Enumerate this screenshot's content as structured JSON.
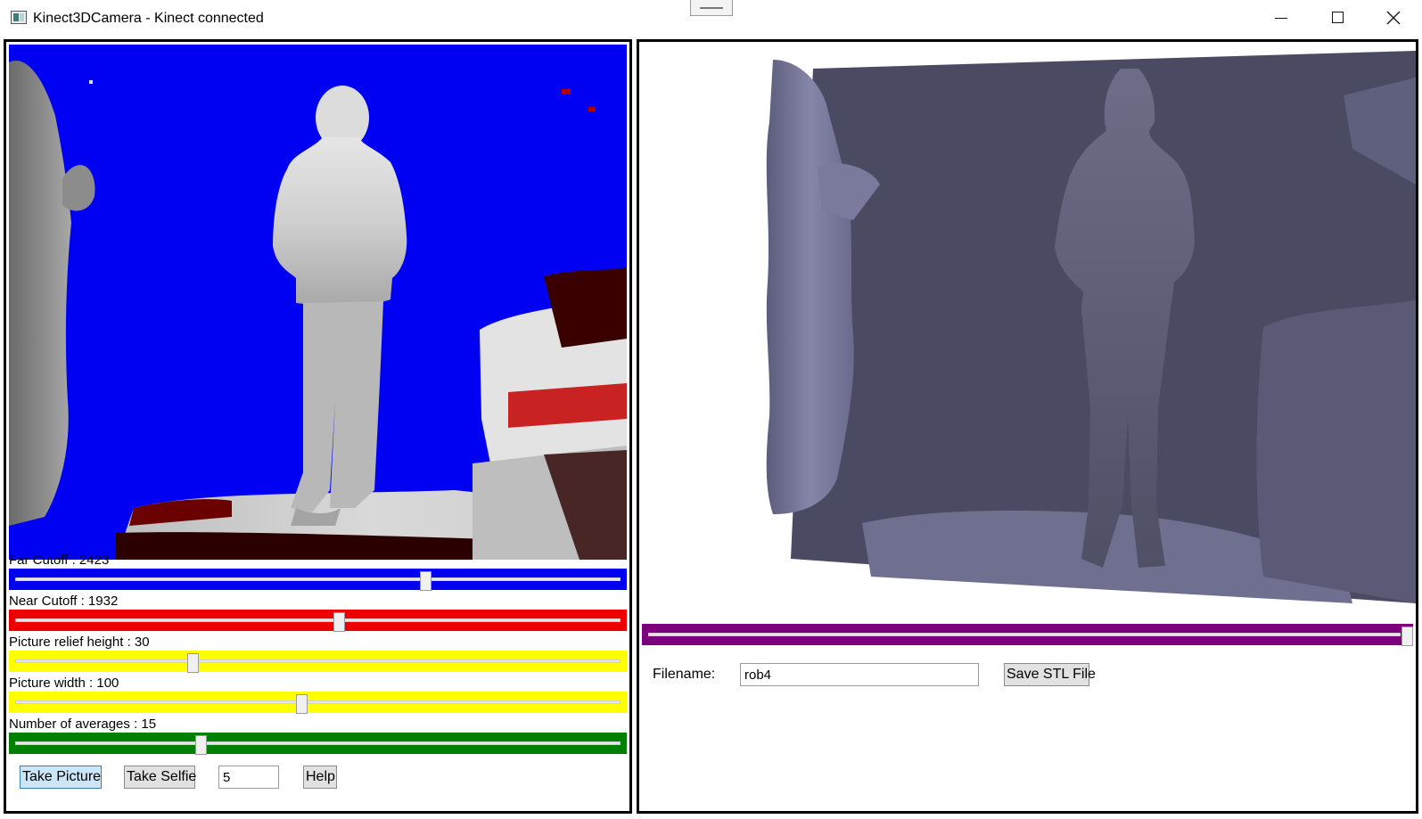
{
  "window": {
    "title": "Kinect3DCamera - Kinect connected",
    "controls": [
      "minimize",
      "maximize",
      "close"
    ]
  },
  "depth_view": {
    "background_color": "#0000f2"
  },
  "sliders": [
    {
      "id": "far_cutoff",
      "label": "Far Cutoff : 2423",
      "color": "#0000ee",
      "position_fraction": 0.678
    },
    {
      "id": "near_cutoff",
      "label": "Near Cutoff : 1932",
      "color": "#ee0000",
      "position_fraction": 0.536
    },
    {
      "id": "relief_height",
      "label": "Picture relief height : 30",
      "color": "#ffff00",
      "position_fraction": 0.294
    },
    {
      "id": "picture_width",
      "label": "Picture width : 100",
      "color": "#ffff00",
      "position_fraction": 0.473
    },
    {
      "id": "num_averages",
      "label": "Number of averages : 15",
      "color": "#008000",
      "position_fraction": 0.308
    }
  ],
  "buttons": {
    "take_picture": "Take Picture",
    "take_selfie": "Take Selfie",
    "help": "Help",
    "save_stl": "Save STL File"
  },
  "selfie_delay_value": "5",
  "model_view": {
    "surface_color": "#4a4a63"
  },
  "rotate_slider": {
    "color": "#7d007d",
    "position_fraction": 1.0
  },
  "filename": {
    "label": "Filename:",
    "value": "rob4"
  }
}
